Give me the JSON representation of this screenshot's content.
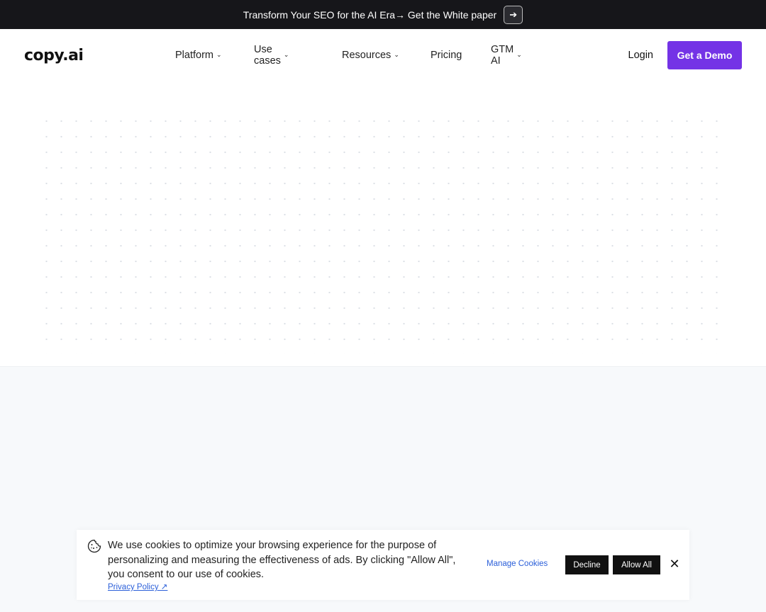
{
  "announcement": {
    "text": "Transform Your SEO for the AI Era→ Get the White paper",
    "arrow_icon": "➔"
  },
  "header": {
    "logo": "copy.ai",
    "nav": [
      {
        "label": "Platform",
        "dropdown": true
      },
      {
        "label": "Use cases",
        "dropdown": true
      },
      {
        "label": "Resources",
        "dropdown": true
      },
      {
        "label": "Pricing",
        "dropdown": false
      },
      {
        "label": "GTM AI",
        "dropdown": true
      }
    ],
    "login": "Login",
    "cta": "Get a Demo"
  },
  "cookie_banner": {
    "message": "We use cookies to optimize your browsing experience for the purpose of personalizing and measuring the effectiveness of ads. By clicking \"Allow All\", you consent to our use of cookies.",
    "privacy_link": "Privacy Policy ↗",
    "manage": "Manage Cookies",
    "decline": "Decline",
    "allow_all": "Allow All",
    "close_icon": "✕"
  },
  "colors": {
    "accent": "#7433e6",
    "announce_bg": "#16161a",
    "link": "#2b5fd9"
  }
}
